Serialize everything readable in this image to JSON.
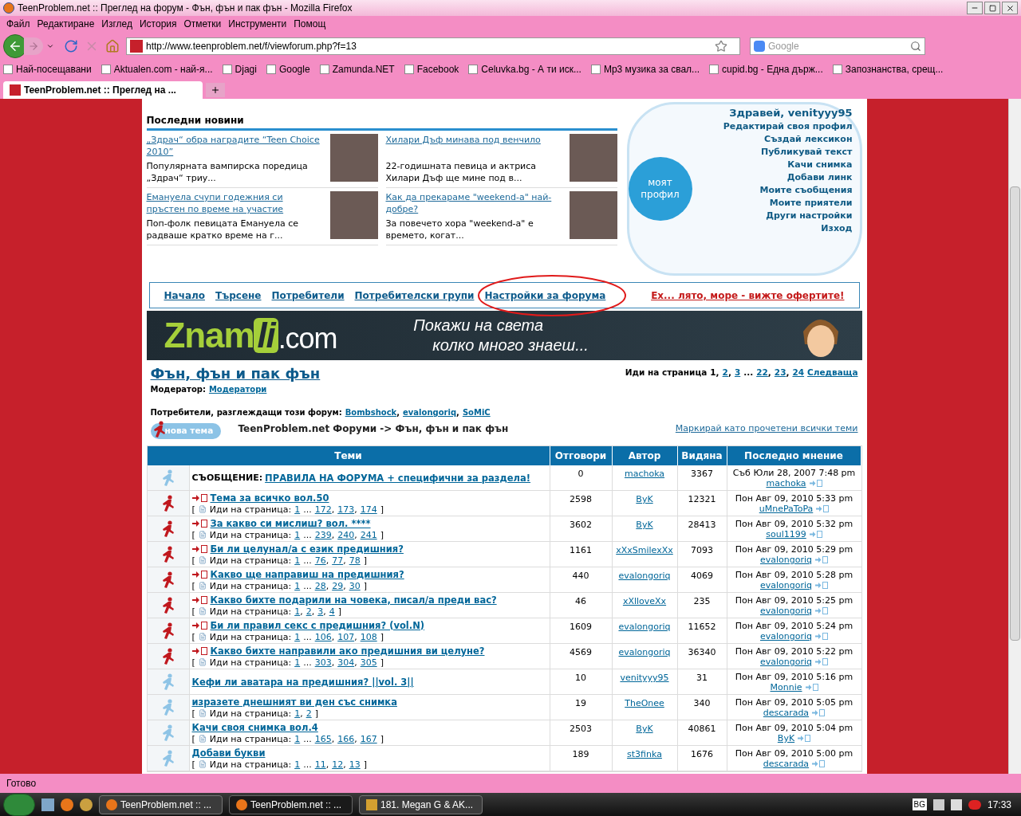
{
  "window": {
    "title": "TeenProblem.net :: Преглед на форум - Фън, фън и пак фън - Mozilla Firefox"
  },
  "menu": [
    "Файл",
    "Редактиране",
    "Изглед",
    "История",
    "Отметки",
    "Инструменти",
    "Помощ"
  ],
  "address": {
    "value": "http://www.teenproblem.net/f/viewforum.php?f=13"
  },
  "search": {
    "placeholder": "Google"
  },
  "bookmarks": [
    {
      "label": "Най-посещавани"
    },
    {
      "label": "Aktualen.com - най-я..."
    },
    {
      "label": "Djagi"
    },
    {
      "label": "Google"
    },
    {
      "label": "Zamunda.NET"
    },
    {
      "label": "Facebook"
    },
    {
      "label": "Celuvka.bg - А ти иск..."
    },
    {
      "label": "Mp3 музика за свал..."
    },
    {
      "label": "cupid.bg - Една държ..."
    },
    {
      "label": "Запознанства, срещ..."
    }
  ],
  "tabs": [
    {
      "label": "TeenProblem.net :: Преглед на ...",
      "selected": true
    }
  ],
  "news": {
    "title": "Последни новини",
    "items": [
      {
        "title": "„Здрач“ обра наградите “Teen Choice 2010”",
        "text": "Популярната вампирска поредица „Здрач“ триу..."
      },
      {
        "title": "Хилари Дъф минава под венчило",
        "text": "22-годишната певица и актриса Хилари Дъф ще мине под в..."
      },
      {
        "title": "Емануела счупи годежния си пръстен по време на участие",
        "text": "Поп-фолк певицата Емануела се радваше кратко време на г..."
      },
      {
        "title": "Как да прекараме \"weekend-a\" най-добре?",
        "text": "За повечето хора \"weekend-a\" е времето, когат..."
      }
    ]
  },
  "profile": {
    "greeting": "Здравей, venityyy95",
    "bubble": "моят профил",
    "links": [
      "Редактирай своя профил",
      "Създай лексикон",
      "Публикувай текст",
      "Качи снимка",
      "Добави линк",
      "Моите съобщения",
      "Моите приятели",
      "Други настройки",
      "Изход"
    ]
  },
  "nav": {
    "links": [
      {
        "label": "Начало",
        "circled": false
      },
      {
        "label": "Търсене",
        "circled": false
      },
      {
        "label": "Потребители",
        "circled": false
      },
      {
        "label": "Потребителски групи",
        "circled": false
      },
      {
        "label": "Настройки за форума",
        "circled": true
      }
    ],
    "promo": "Ех... лято, море - вижте офертите!"
  },
  "banner": {
    "logo_main": "Znam",
    "logo_accent": "li",
    "logo_suffix": ".com",
    "line1": "Покажи на света",
    "line2": "колко много знаеш..."
  },
  "forum": {
    "title": "Фън, фън и пак фън",
    "moderator_label": "Модератор:",
    "moderator": "Модератори",
    "pager": {
      "label": "Иди на страница",
      "items": [
        {
          "label": "1",
          "link": false,
          "sep": ","
        },
        {
          "label": "2",
          "link": true,
          "sep": ","
        },
        {
          "label": "3",
          "link": true
        },
        {
          "label": "...",
          "link": false
        },
        {
          "label": "22",
          "link": true,
          "sep": ","
        },
        {
          "label": "23",
          "link": true,
          "sep": ","
        },
        {
          "label": "24",
          "link": true
        },
        {
          "label": "Следваща",
          "link": true
        }
      ]
    },
    "viewers_label": "Потребители, разглеждащи този форум:",
    "viewers": [
      {
        "name": "Bombshock",
        "sep": ","
      },
      {
        "name": "evalongoriq",
        "sep": ","
      },
      {
        "name": "SoMiC"
      }
    ],
    "new_topic": "нова тема",
    "breadcrumb": "TeenProblem.net Форуми -> Фън, фън и пак фън",
    "mark_read": "Маркирай като прочетени всички теми"
  },
  "table": {
    "columns": [
      "Теми",
      "Отговори",
      "Автор",
      "Видяна",
      "Последно мнение"
    ],
    "rows": [
      {
        "kind": "announce",
        "unread": false,
        "prefix": "СЪОБЩЕНИЕ:",
        "title": "ПРАВИЛА НА ФОРУМА + специфични за раздела!",
        "replies": "0",
        "author": "machoka",
        "views": "3367",
        "last_date": "Съб Юли 28, 2007 7:48 pm",
        "last_by": "machoka"
      },
      {
        "kind": "hot",
        "unread": true,
        "title": "Тема за всичко вол.50",
        "pages": {
          "open": "[",
          "label": "Иди на страница:",
          "items": [
            {
              "label": "1",
              "link": true
            },
            {
              "label": "...",
              "link": false
            },
            {
              "label": "172",
              "link": true,
              "sep": ","
            },
            {
              "label": "173",
              "link": true,
              "sep": ","
            },
            {
              "label": "174",
              "link": true
            }
          ],
          "close": "]"
        },
        "replies": "2598",
        "author": "ByK",
        "views": "12321",
        "last_date": "Пон Авг 09, 2010 5:33 pm",
        "last_by": "uMnePaToPa"
      },
      {
        "kind": "hot",
        "unread": true,
        "title": "За какво си мислиш? вол. ****",
        "pages": {
          "open": "[",
          "label": "Иди на страница:",
          "items": [
            {
              "label": "1",
              "link": true
            },
            {
              "label": "...",
              "link": false
            },
            {
              "label": "239",
              "link": true,
              "sep": ","
            },
            {
              "label": "240",
              "link": true,
              "sep": ","
            },
            {
              "label": "241",
              "link": true
            }
          ],
          "close": "]"
        },
        "replies": "3602",
        "author": "ByK",
        "views": "28413",
        "last_date": "Пон Авг 09, 2010 5:32 pm",
        "last_by": "soul1199"
      },
      {
        "kind": "hot",
        "unread": true,
        "title": "Би ли целунал/а с език предишния?",
        "pages": {
          "open": "[",
          "label": "Иди на страница:",
          "items": [
            {
              "label": "1",
              "link": true
            },
            {
              "label": "...",
              "link": false
            },
            {
              "label": "76",
              "link": true,
              "sep": ","
            },
            {
              "label": "77",
              "link": true,
              "sep": ","
            },
            {
              "label": "78",
              "link": true
            }
          ],
          "close": "]"
        },
        "replies": "1161",
        "author": "xXxSmilexXx",
        "views": "7093",
        "last_date": "Пон Авг 09, 2010 5:29 pm",
        "last_by": "evalongoriq"
      },
      {
        "kind": "hot",
        "unread": true,
        "title": "Какво ще направиш на предишния?",
        "pages": {
          "open": "[",
          "label": "Иди на страница:",
          "items": [
            {
              "label": "1",
              "link": true
            },
            {
              "label": "...",
              "link": false
            },
            {
              "label": "28",
              "link": true,
              "sep": ","
            },
            {
              "label": "29",
              "link": true,
              "sep": ","
            },
            {
              "label": "30",
              "link": true
            }
          ],
          "close": "]"
        },
        "replies": "440",
        "author": "evalongoriq",
        "views": "4069",
        "last_date": "Пон Авг 09, 2010 5:28 pm",
        "last_by": "evalongoriq"
      },
      {
        "kind": "hot",
        "unread": true,
        "title": "Какво бихте подарили на човека, писал/а преди вас?",
        "pages": {
          "open": "[",
          "label": "Иди на страница:",
          "items": [
            {
              "label": "1",
              "link": true,
              "sep": ","
            },
            {
              "label": "2",
              "link": true,
              "sep": ","
            },
            {
              "label": "3",
              "link": true,
              "sep": ","
            },
            {
              "label": "4",
              "link": true
            }
          ],
          "close": "]"
        },
        "replies": "46",
        "author": "xXlloveXx",
        "views": "235",
        "last_date": "Пон Авг 09, 2010 5:25 pm",
        "last_by": "evalongoriq"
      },
      {
        "kind": "hot",
        "unread": true,
        "title": "Би ли правил секс с предишния? (vol.N)",
        "pages": {
          "open": "[",
          "label": "Иди на страница:",
          "items": [
            {
              "label": "1",
              "link": true
            },
            {
              "label": "...",
              "link": false
            },
            {
              "label": "106",
              "link": true,
              "sep": ","
            },
            {
              "label": "107",
              "link": true,
              "sep": ","
            },
            {
              "label": "108",
              "link": true
            }
          ],
          "close": "]"
        },
        "replies": "1609",
        "author": "evalongoriq",
        "views": "11652",
        "last_date": "Пон Авг 09, 2010 5:24 pm",
        "last_by": "evalongoriq"
      },
      {
        "kind": "hot",
        "unread": true,
        "title": "Какво бихте направили ако предишния ви целуне?",
        "pages": {
          "open": "[",
          "label": "Иди на страница:",
          "items": [
            {
              "label": "1",
              "link": true
            },
            {
              "label": "...",
              "link": false
            },
            {
              "label": "303",
              "link": true,
              "sep": ","
            },
            {
              "label": "304",
              "link": true,
              "sep": ","
            },
            {
              "label": "305",
              "link": true
            }
          ],
          "close": "]"
        },
        "replies": "4569",
        "author": "evalongoriq",
        "views": "36340",
        "last_date": "Пон Авг 09, 2010 5:22 pm",
        "last_by": "evalongoriq"
      },
      {
        "kind": "normal",
        "unread": false,
        "title": "Кефи ли аватара на предишния? ||vol. 3||",
        "replies": "10",
        "author": "venityyy95",
        "views": "31",
        "last_date": "Пон Авг 09, 2010 5:16 pm",
        "last_by": "Monnie"
      },
      {
        "kind": "normal",
        "unread": false,
        "title": "изразете днешният ви ден със снимка",
        "pages": {
          "open": "[",
          "label": "Иди на страница:",
          "items": [
            {
              "label": "1",
              "link": true,
              "sep": ","
            },
            {
              "label": "2",
              "link": true
            }
          ],
          "close": "]"
        },
        "replies": "19",
        "author": "TheOnee",
        "views": "340",
        "last_date": "Пон Авг 09, 2010 5:05 pm",
        "last_by": "descarada"
      },
      {
        "kind": "normal",
        "unread": false,
        "title": "Качи своя снимка вол.4",
        "pages": {
          "open": "[",
          "label": "Иди на страница:",
          "items": [
            {
              "label": "1",
              "link": true
            },
            {
              "label": "...",
              "link": false
            },
            {
              "label": "165",
              "link": true,
              "sep": ","
            },
            {
              "label": "166",
              "link": true,
              "sep": ","
            },
            {
              "label": "167",
              "link": true
            }
          ],
          "close": "]"
        },
        "replies": "2503",
        "author": "ByK",
        "views": "40861",
        "last_date": "Пон Авг 09, 2010 5:04 pm",
        "last_by": "ByK"
      },
      {
        "kind": "normal",
        "unread": false,
        "title": "Добави букви",
        "pages": {
          "open": "[",
          "label": "Иди на страница:",
          "items": [
            {
              "label": "1",
              "link": true
            },
            {
              "label": "...",
              "link": false
            },
            {
              "label": "11",
              "link": true,
              "sep": ","
            },
            {
              "label": "12",
              "link": true,
              "sep": ","
            },
            {
              "label": "13",
              "link": true
            }
          ],
          "close": "]"
        },
        "replies": "189",
        "author": "st3finka",
        "views": "1676",
        "last_date": "Пон Авг 09, 2010 5:00 pm",
        "last_by": "descarada"
      }
    ]
  },
  "status_bar": {
    "text": "Готово"
  },
  "taskbar": {
    "tasks": [
      {
        "label": "TeenProblem.net :: ...",
        "kind": "browser",
        "selected": false
      },
      {
        "label": "TeenProblem.net :: ...",
        "kind": "browser",
        "selected": true
      },
      {
        "label": "181. Megan G & AK...",
        "kind": "player",
        "selected": false
      }
    ],
    "language": "BG",
    "clock": "17:33"
  }
}
